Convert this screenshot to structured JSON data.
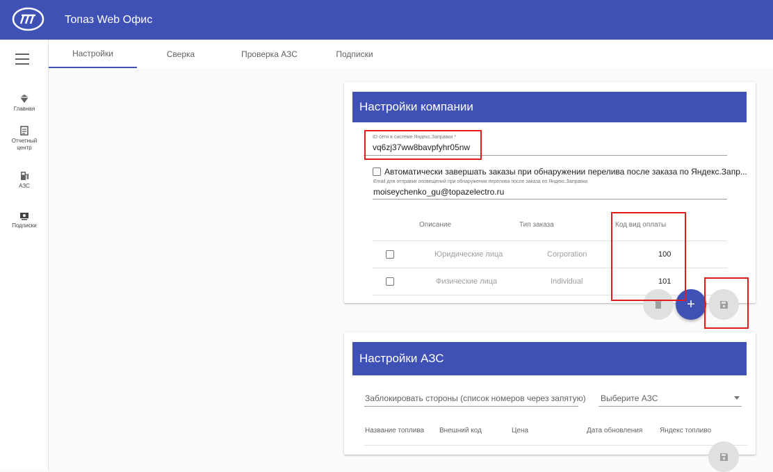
{
  "app": {
    "title": "Топаз Web Офис"
  },
  "sidebar": {
    "items": [
      {
        "label": "Главная",
        "icon": "home-icon"
      },
      {
        "label": "Отчетный центр",
        "icon": "report-icon"
      },
      {
        "label": "АЗС",
        "icon": "fuel-station-icon"
      },
      {
        "label": "Подписки",
        "icon": "subscription-icon"
      }
    ]
  },
  "tabs": [
    {
      "label": "Настройки",
      "active": true
    },
    {
      "label": "Сверка",
      "active": false
    },
    {
      "label": "Проверка АЗС",
      "active": false
    },
    {
      "label": "Подписки",
      "active": false
    }
  ],
  "company": {
    "title": "Настройки компании",
    "network_id_label": "ID сети в системе Яндекс.Заправки *",
    "network_id_value": "vq6zj37ww8bavpfyhr05nw",
    "auto_complete_label": "Автоматически завершать заказы при обнаружении перелива после заказа по Яндекс.Запр...",
    "auto_complete_checked": false,
    "email_label": "Email для отправки оповещений при обнаружении перелива после заказа по Яндекс.Заправки",
    "email_value": "moiseychenko_gu@topazelectro.ru",
    "table": {
      "headers": [
        "Описание",
        "Тип заказа",
        "Код вид оплаты"
      ],
      "rows": [
        {
          "description": "Юридические лица",
          "type": "Corporation",
          "code": "100"
        },
        {
          "description": "Физические лица",
          "type": "Individual",
          "code": "101"
        }
      ]
    },
    "add_symbol": "+"
  },
  "azs": {
    "title": "Настройки АЗС",
    "block_sides_placeholder": "Заблокировать стороны (список номеров через запятую)",
    "select_placeholder": "Выберите АЗС",
    "columns": [
      "Название топлива",
      "Внешний код",
      "Цена",
      "Дата обновления",
      "Яндекс топливо"
    ]
  },
  "colors": {
    "primary": "#3f51b5",
    "highlight": "#e21a1a"
  }
}
